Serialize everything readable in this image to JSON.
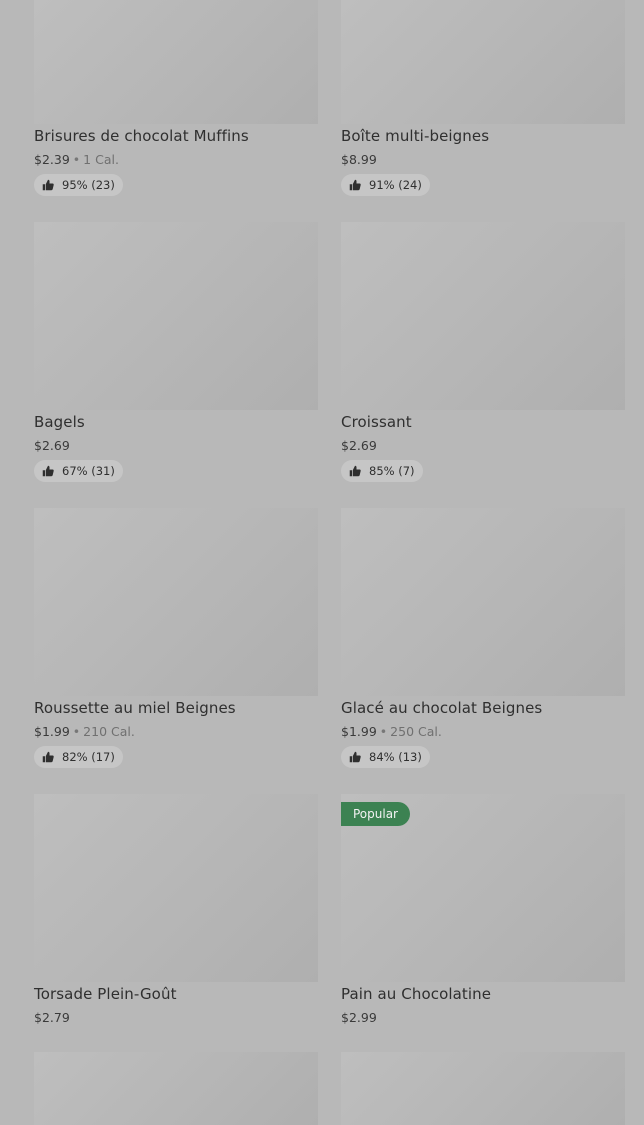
{
  "items": [
    {
      "name": "Brisures de chocolat Muffins",
      "price": "$2.39",
      "sep": "•",
      "cal": "1 Cal.",
      "rating": "95% (23)"
    },
    {
      "name": "Boîte multi-beignes",
      "price": "$8.99",
      "rating": "91% (24)"
    },
    {
      "name": "Bagels",
      "price": "$2.69",
      "rating": "67% (31)"
    },
    {
      "name": "Croissant",
      "price": "$2.69",
      "rating": "85% (7)"
    },
    {
      "name": "Roussette au miel Beignes",
      "price": "$1.99",
      "sep": "•",
      "cal": "210 Cal.",
      "rating": "82% (17)"
    },
    {
      "name": "Glacé au chocolat Beignes",
      "price": "$1.99",
      "sep": "•",
      "cal": "250 Cal.",
      "rating": "84% (13)"
    },
    {
      "name": "Torsade Plein-Goût",
      "price": "$2.79"
    },
    {
      "name": "Pain au Chocolatine",
      "price": "$2.99",
      "badge": "Popular"
    }
  ],
  "colors": {
    "overlay": "#b8b8b8",
    "badge": "#3c8252",
    "text": "#2f2f2f"
  },
  "icons": {
    "rating": "thumbs-up-icon"
  }
}
